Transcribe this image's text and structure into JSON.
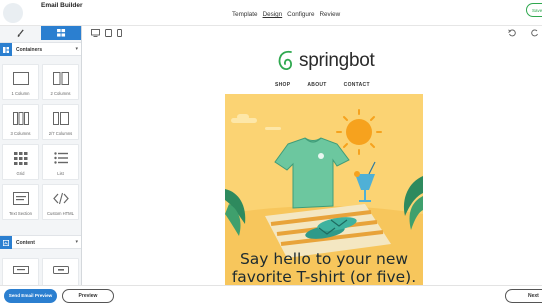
{
  "header": {
    "app_title": "Email Builder",
    "nav": [
      "Template",
      "Design",
      "Configure",
      "Review"
    ],
    "active_nav": "Design",
    "save_label": "Save"
  },
  "left_panel": {
    "tabs": [
      {
        "icon": "brush-icon"
      },
      {
        "icon": "grid-icon"
      }
    ],
    "sections": [
      {
        "label": "Containers",
        "icon": "layout-icon"
      },
      {
        "label": "Content",
        "icon": "content-icon"
      }
    ],
    "containers": [
      {
        "label": "1 Column",
        "icon": "one-column-icon"
      },
      {
        "label": "2 Columns",
        "icon": "two-columns-icon"
      },
      {
        "label": "3 Columns",
        "icon": "three-columns-icon"
      },
      {
        "label": "2/7 Columns",
        "icon": "two-seven-columns-icon"
      },
      {
        "label": "Grid",
        "icon": "grid-dots-icon"
      },
      {
        "label": "List",
        "icon": "list-icon"
      },
      {
        "label": "Text Section",
        "icon": "text-section-icon"
      },
      {
        "label": "Custom HTML",
        "icon": "code-icon"
      }
    ]
  },
  "toolbar": {
    "devices": [
      "desktop-icon",
      "tablet-icon",
      "mobile-icon"
    ],
    "undo_icon": "undo-icon",
    "redo_icon": "redo-icon"
  },
  "email": {
    "brand": "springbot",
    "brand_color": "#2fa84f",
    "nav": [
      "SHOP",
      "ABOUT",
      "CONTACT"
    ],
    "headline_line1": "Say hello to your new",
    "headline_line2": "favorite T-shirt (or five)."
  },
  "footer": {
    "send_preview": "Send Email Preview",
    "preview": "Preview",
    "next": "Next"
  }
}
